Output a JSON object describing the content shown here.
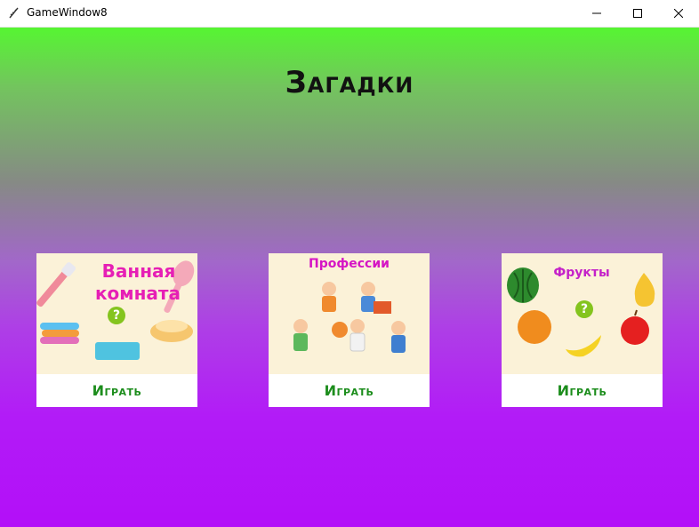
{
  "window": {
    "title": "GameWindow8",
    "icon": "feather-icon"
  },
  "controls": {
    "minimize": "minimize-icon",
    "maximize": "maximize-icon",
    "close": "close-icon"
  },
  "page": {
    "title": "Загадки"
  },
  "cards": [
    {
      "label_lines": [
        "Ванная",
        "комната"
      ],
      "label_color": "#e61fb5",
      "button": "Играть"
    },
    {
      "label": "Профессии",
      "label_color": "#d515c4",
      "button": "Играть"
    },
    {
      "label": "Фрукты",
      "label_color": "#c421c9",
      "button": "Играть"
    }
  ],
  "colors": {
    "top": "#56f532",
    "bottom": "#b30ff8",
    "button_text": "#1c8d1c"
  }
}
